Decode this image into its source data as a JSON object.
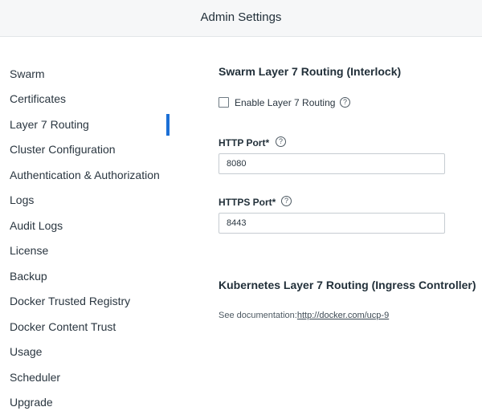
{
  "header": {
    "title": "Admin Settings"
  },
  "sidebar": {
    "items": [
      {
        "label": "Swarm"
      },
      {
        "label": "Certificates"
      },
      {
        "label": "Layer 7 Routing"
      },
      {
        "label": "Cluster Configuration"
      },
      {
        "label": "Authentication & Authorization"
      },
      {
        "label": "Logs"
      },
      {
        "label": "Audit Logs"
      },
      {
        "label": "License"
      },
      {
        "label": "Backup"
      },
      {
        "label": "Docker Trusted Registry"
      },
      {
        "label": "Docker Content Trust"
      },
      {
        "label": "Usage"
      },
      {
        "label": "Scheduler"
      },
      {
        "label": "Upgrade"
      }
    ],
    "active": "Layer 7 Routing",
    "accent_color": "#1b6fd6"
  },
  "swarm_section": {
    "title": "Swarm Layer 7 Routing (Interlock)",
    "enable_label": "Enable Layer 7 Routing",
    "enable_checked": false,
    "http_port": {
      "label": "HTTP Port*",
      "value": "8080"
    },
    "https_port": {
      "label": "HTTPS Port*",
      "value": "8443"
    },
    "help_icon": "help-circle-icon"
  },
  "kubernetes_section": {
    "title": "Kubernetes Layer 7 Routing (Ingress Controller)",
    "doc_prefix": "See documentation:",
    "doc_link": "http://docker.com/ucp-9"
  }
}
